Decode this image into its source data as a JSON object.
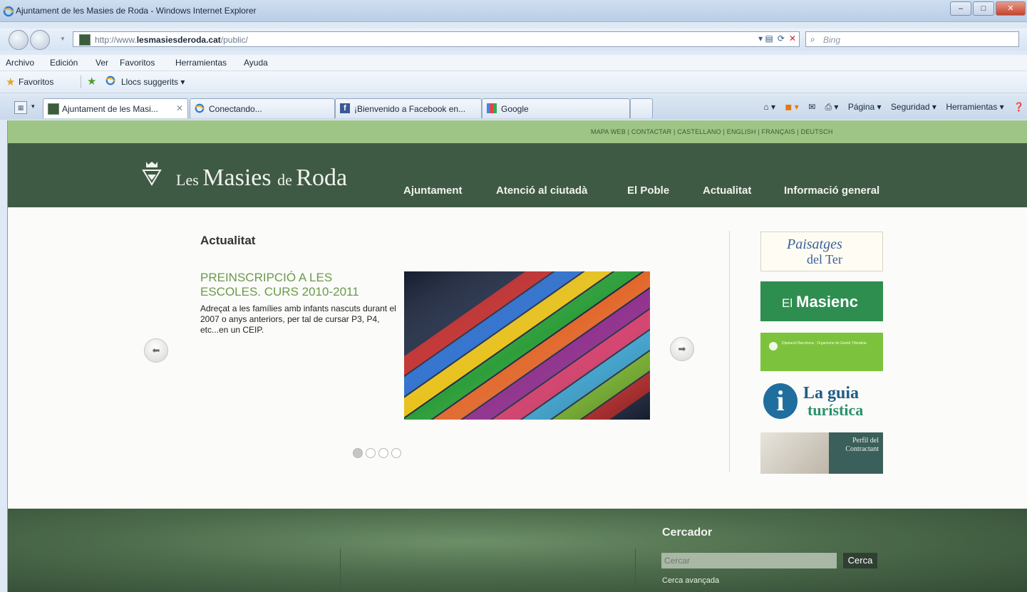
{
  "window": {
    "title": "Ajuntament de les Masies de Roda - Windows Internet Explorer",
    "controls": [
      "–",
      "□",
      "✕"
    ]
  },
  "address": {
    "url_prefix": "http://www.",
    "url_domain": "lesmasiesderoda.cat",
    "url_path": "/public/",
    "search_placeholder": "Bing"
  },
  "menu": [
    "Archivo",
    "Edición",
    "Ver",
    "Favoritos",
    "Herramientas",
    "Ayuda"
  ],
  "favorites_bar": {
    "favorites_label": "Favoritos",
    "suggested_label": "Llocs suggerits ▾"
  },
  "tabs": [
    {
      "label": "Ajuntament de les Masi...",
      "close": "✕"
    },
    {
      "label": "Conectando..."
    },
    {
      "label": "¡Bienvenido a Facebook en..."
    },
    {
      "label": "Google"
    }
  ],
  "command_bar": [
    "Página ▾",
    "Seguridad ▾",
    "Herramientas ▾"
  ],
  "site": {
    "top_links": "MAPA WEB  |  CONTACTAR  |  CASTELLANO  |  ENGLISH  |  FRANÇAIS  |  DEUTSCH",
    "name_part1": "Les ",
    "name_part2": "Masies ",
    "name_part3": "de ",
    "name_part4": "Roda",
    "nav": [
      "Ajuntament",
      "Atenció al ciutadà",
      "El Poble",
      "Actualitat",
      "Informació general"
    ]
  },
  "news": {
    "section_title": "Actualitat",
    "headline": "PREINSCRIPCIÓ A LES ESCOLES. CURS 2010-2011",
    "body": "Adreçat a les famílies amb infants nascuts durant el 2007 o anys anteriors, per tal de cursar P3, P4, etc...en un CEIP."
  },
  "banners": {
    "paisatges_line1": "Paisatges",
    "paisatges_line2": "del Ter",
    "masienc_el": "El",
    "masienc_name": "Masienc",
    "diputacio": "Diputació Barcelona · Organisme de Gestió Tributària",
    "guia_line1": "La guia",
    "guia_line2": "turística",
    "perfil": "Perfil del Contractant"
  },
  "search": {
    "title": "Cercador",
    "placeholder": "Cercar",
    "button": "Cerca",
    "advanced": "Cerca avançada"
  },
  "colors": {
    "header_green": "#3f5a44",
    "strip_green": "#9ec585",
    "headline_green": "#6b9a4c"
  }
}
